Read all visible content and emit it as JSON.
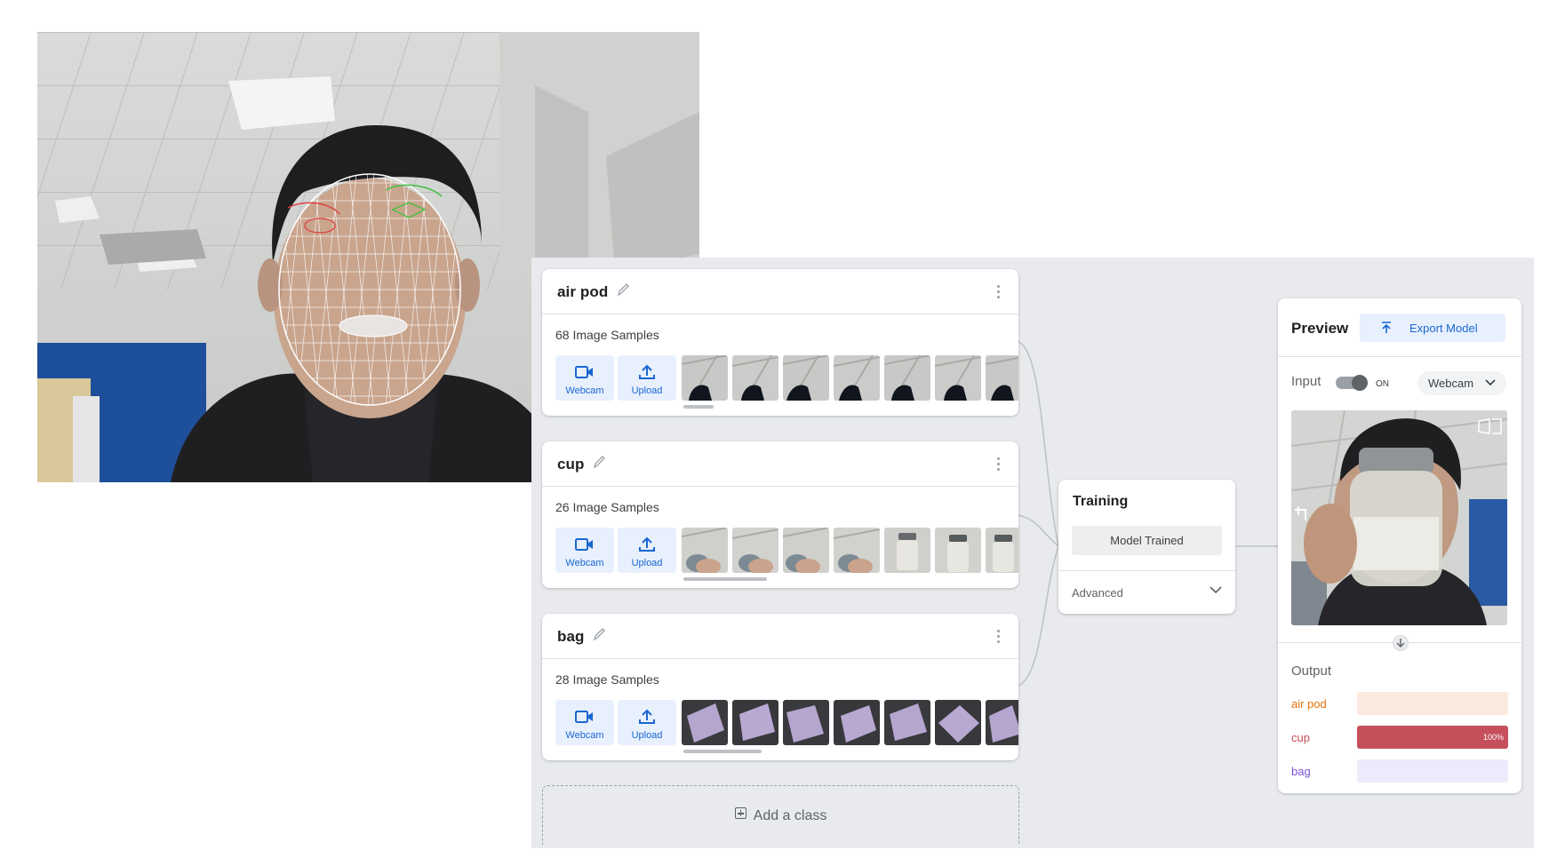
{
  "classes": [
    {
      "name": "air pod",
      "samples": "68 Image Samples",
      "webcam": "Webcam",
      "upload": "Upload"
    },
    {
      "name": "cup",
      "samples": "26 Image Samples",
      "webcam": "Webcam",
      "upload": "Upload"
    },
    {
      "name": "bag",
      "samples": "28 Image Samples",
      "webcam": "Webcam",
      "upload": "Upload"
    }
  ],
  "add_class": "Add a class",
  "training": {
    "title": "Training",
    "button": "Model Trained",
    "advanced": "Advanced"
  },
  "preview": {
    "title": "Preview",
    "export": "Export Model",
    "input_label": "Input",
    "toggle_state": "ON",
    "source": "Webcam",
    "output_label": "Output",
    "outputs": [
      {
        "label": "air pod",
        "confidence": 0,
        "pct_text": "",
        "color": "#e8710a",
        "track": "#fbeadf"
      },
      {
        "label": "cup",
        "confidence": 1.0,
        "pct_text": "100%",
        "color": "#c5505c",
        "track": "#f8dfe2"
      },
      {
        "label": "bag",
        "confidence": 0,
        "pct_text": "",
        "color": "#7b4fd6",
        "track": "#eeeafb"
      }
    ]
  },
  "colors": {
    "accent_blue": "#1967d2",
    "panel_bg": "#e8eaed"
  }
}
